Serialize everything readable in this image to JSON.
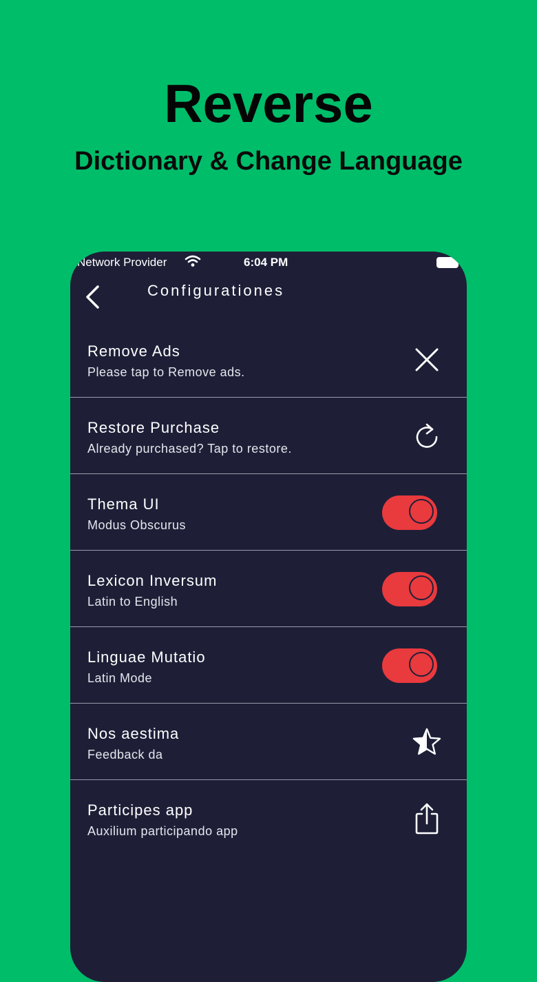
{
  "promo": {
    "title": "Reverse",
    "subtitle": "Dictionary & Change Language"
  },
  "status_bar": {
    "provider": "Network Provider",
    "time": "6:04 PM"
  },
  "nav": {
    "title": "Configurationes"
  },
  "settings": [
    {
      "title": "Remove Ads",
      "subtitle": "Please tap to Remove ads.",
      "control": "close-icon"
    },
    {
      "title": "Restore Purchase",
      "subtitle": "Already purchased? Tap to restore.",
      "control": "refresh-icon"
    },
    {
      "title": "Thema UI",
      "subtitle": "Modus Obscurus",
      "control": "toggle",
      "on": true
    },
    {
      "title": "Lexicon Inversum",
      "subtitle": "Latin to English",
      "control": "toggle",
      "on": true
    },
    {
      "title": "Linguae Mutatio",
      "subtitle": "Latin Mode",
      "control": "toggle",
      "on": true
    },
    {
      "title": "Nos aestima",
      "subtitle": "Feedback da",
      "control": "star-icon"
    },
    {
      "title": "Participes app",
      "subtitle": "Auxilium participando app",
      "control": "share-icon"
    }
  ],
  "colors": {
    "background": "#00BD6A",
    "phone": "#1E1F37",
    "toggle_on": "#E93A3E"
  }
}
